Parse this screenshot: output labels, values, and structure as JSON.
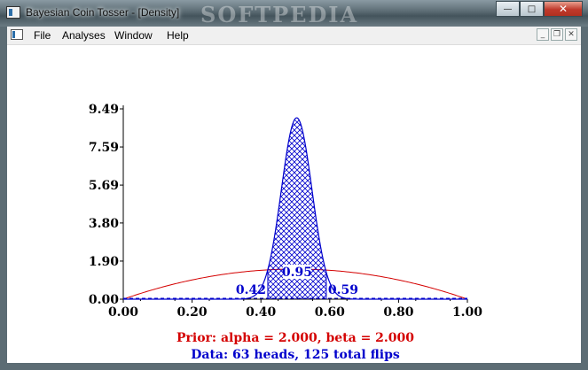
{
  "window": {
    "title": "Bayesian Coin Tosser - [Density]",
    "watermark": "SOFTPEDIA"
  },
  "menu": {
    "items": [
      "File",
      "Analyses",
      "Window",
      "Help"
    ]
  },
  "window_buttons": {
    "minimize": "—",
    "maximize": "□",
    "close": "✕"
  },
  "mdi_buttons": {
    "minimize": "_",
    "restore": "❐",
    "close": "✕"
  },
  "chart_data": {
    "type": "area",
    "xlim": [
      0.0,
      1.0
    ],
    "ylim": [
      0.0,
      9.49
    ],
    "x_ticks": [
      "0.00",
      "0.20",
      "0.40",
      "0.60",
      "0.80",
      "1.00"
    ],
    "y_ticks": [
      "0.00",
      "1.90",
      "3.80",
      "5.69",
      "7.59",
      "9.49"
    ],
    "prior": {
      "alpha": 2.0,
      "beta": 2.0,
      "color": "#d40000"
    },
    "posterior": {
      "heads": 63,
      "total": 125,
      "color": "#0000cc"
    },
    "interval": {
      "lower": 0.42,
      "upper": 0.59,
      "probability": 0.95
    },
    "labels": {
      "lower": "0.42",
      "upper": "0.59",
      "probability": "0.95",
      "prior": "Prior: alpha = 2.000, beta = 2.000",
      "data": "Data: 63 heads, 125 total flips"
    }
  }
}
